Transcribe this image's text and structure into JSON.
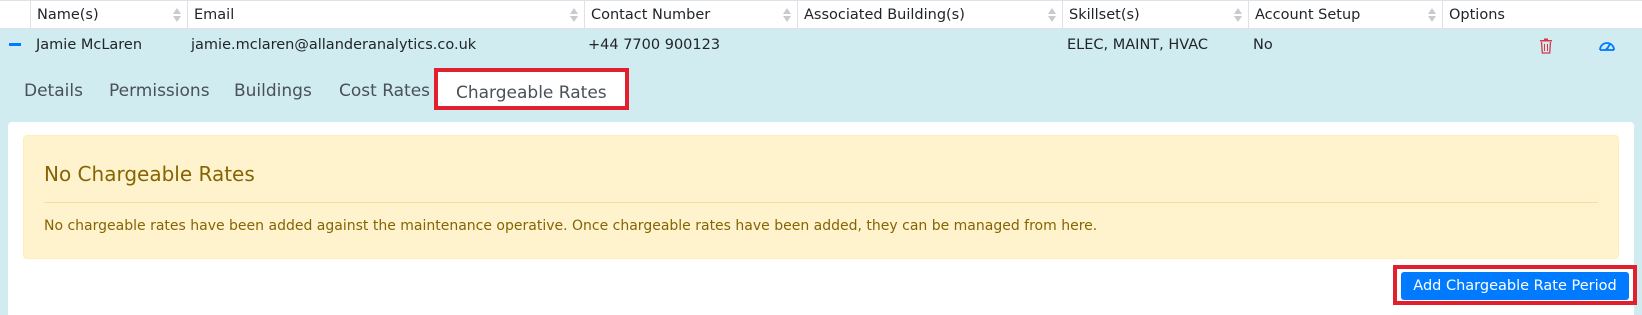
{
  "columns": {
    "name": "Name(s)",
    "email": "Email",
    "contact": "Contact Number",
    "buildings": "Associated Building(s)",
    "skillset": "Skillset(s)",
    "account": "Account Setup",
    "options": "Options"
  },
  "row": {
    "name": "Jamie McLaren",
    "email": "jamie.mclaren@allanderanalytics.co.uk",
    "contact": "+44 7700 900123",
    "buildings": "",
    "skillset": "ELEC, MAINT, HVAC",
    "account": "No"
  },
  "tabs": {
    "details": "Details",
    "permissions": "Permissions",
    "buildings": "Buildings",
    "cost_rates": "Cost Rates",
    "chargeable_rates": "Chargeable Rates"
  },
  "alert": {
    "title": "No Chargeable Rates",
    "message": "No chargeable rates have been added against the maintenance operative. Once chargeable rates have been added, they can be managed from here."
  },
  "actions": {
    "add_label": "Add Chargeable Rate Period"
  },
  "icons": {
    "collapse": "minus-icon",
    "delete": "trash-icon",
    "dashboard": "gauge-icon",
    "sort": "sort-icon"
  },
  "colors": {
    "accent": "#007bff",
    "highlight": "#e0202c",
    "row_bg": "#d1ecf1",
    "alert_bg": "#fff3cd",
    "alert_text": "#856404",
    "delete": "#dc3545"
  }
}
